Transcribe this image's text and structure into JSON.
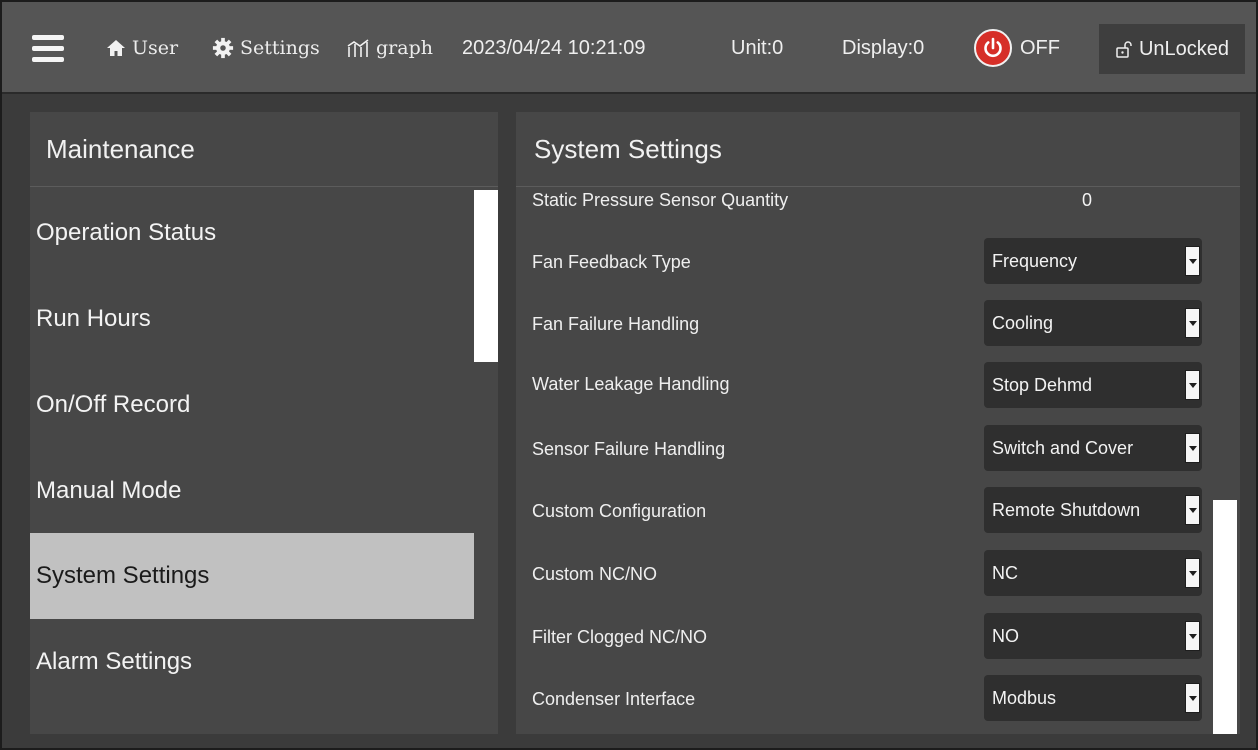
{
  "topbar": {
    "user_label": "User",
    "settings_label": "Settings",
    "graph_label": "graph",
    "datetime": "2023/04/24 10:21:09",
    "unit": "Unit:0",
    "display": "Display:0",
    "power_state": "OFF",
    "lock_state": "UnLocked",
    "icons": [
      "menu-icon",
      "home-icon",
      "gear-icon",
      "graph-icon",
      "power-icon",
      "unlock-icon"
    ],
    "power_color": "#d62f28"
  },
  "sidebar": {
    "title": "Maintenance",
    "items": [
      {
        "label": "Operation Status"
      },
      {
        "label": "Run Hours"
      },
      {
        "label": "On/Off Record"
      },
      {
        "label": "Manual Mode"
      },
      {
        "label": "System Settings"
      },
      {
        "label": "Alarm Settings"
      }
    ],
    "active_item": "System Settings"
  },
  "main": {
    "title": "System Settings",
    "static_row": {
      "label": "Static Pressure Sensor Quantity",
      "value": "0"
    },
    "rows": [
      {
        "label": "Fan Feedback Type",
        "value": "Frequency"
      },
      {
        "label": "Fan Failure Handling",
        "value": "Cooling"
      },
      {
        "label": "Water Leakage Handling",
        "value": "Stop Dehmd"
      },
      {
        "label": "Sensor Failure Handling",
        "value": "Switch and Cover"
      },
      {
        "label": "Custom Configuration",
        "value": "Remote Shutdown"
      },
      {
        "label": "Custom NC/NO",
        "value": "NC"
      },
      {
        "label": "Filter Clogged NC/NO",
        "value": "NO"
      },
      {
        "label": "Condenser Interface",
        "value": "Modbus"
      }
    ]
  }
}
